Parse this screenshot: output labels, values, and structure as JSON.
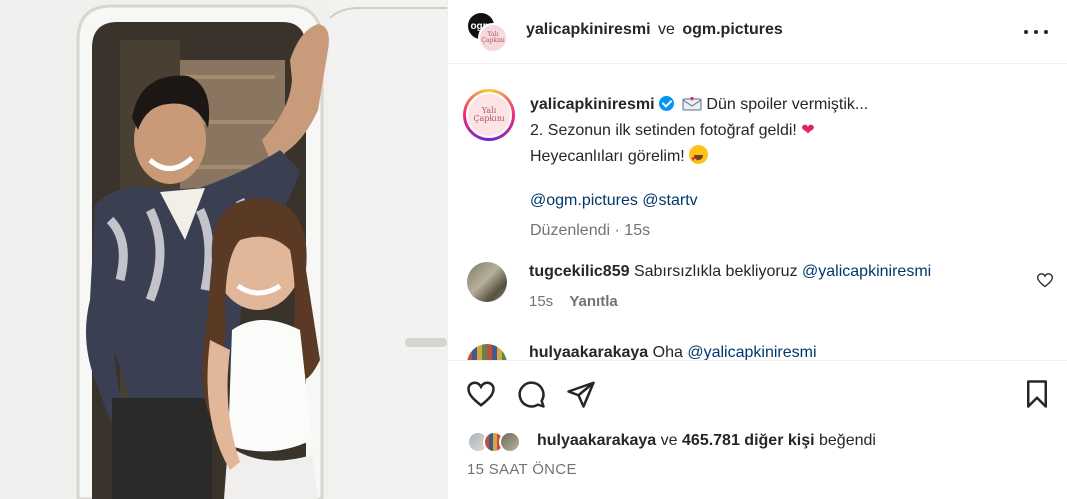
{
  "header": {
    "account_primary": "yalicapkiniresmi",
    "conjunction": "ve",
    "account_secondary": "ogm.pictures",
    "avatar_primary_text": "ogm",
    "avatar_secondary_text": "Yalı Çapkını"
  },
  "caption": {
    "username": "yalicapkiniresmi",
    "line1": "Dün spoiler vermiştik...",
    "line2": "2. Sezonun ilk setinden fotoğraf geldi!",
    "line3": "Heyecanlıları görelim!",
    "mention1": "@ogm.pictures",
    "mention2": "@startv",
    "edited_label": "Düzenlendi",
    "separator": "·",
    "edited_time": "15s",
    "avatar_text": "Yalı Çapkını"
  },
  "comments": [
    {
      "username": "tugcekilic859",
      "text": "Sabırsızlıkla bekliyoruz",
      "mention": "@yalicapkiniresmi",
      "time": "15s",
      "reply_label": "Yanıtla"
    },
    {
      "username": "hulyaakarakaya",
      "text": "Oha",
      "mention": "@yalicapkiniresmi"
    }
  ],
  "likes": {
    "first_user": "hulyaakarakaya",
    "conjunction": "ve",
    "count_text": "465.781 diğer kişi",
    "suffix": "beğendi"
  },
  "timestamp": "15 SAAT ÖNCE",
  "colors": {
    "link": "#00376b",
    "verified": "#0095f6",
    "muted": "#737373",
    "text": "#262626"
  },
  "icons": [
    "more-icon",
    "verified-icon",
    "envelope-icon",
    "heart-emoji",
    "heart-eyes-emoji",
    "small-heart-icon",
    "like-icon",
    "comment-icon",
    "share-icon",
    "bookmark-icon"
  ]
}
